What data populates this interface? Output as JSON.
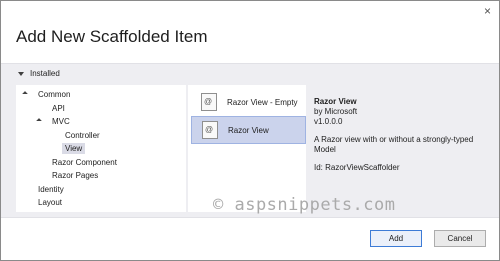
{
  "dialog": {
    "title": "Add New Scaffolded Item",
    "close_glyph": "×"
  },
  "installed_label": "Installed",
  "tree": [
    {
      "label": "Common",
      "level": 0,
      "expanded": true
    },
    {
      "label": "API",
      "level": 1
    },
    {
      "label": "MVC",
      "level": 1,
      "expanded": true
    },
    {
      "label": "Controller",
      "level": 2
    },
    {
      "label": "View",
      "level": 2,
      "selected": true
    },
    {
      "label": "Razor Component",
      "level": 1
    },
    {
      "label": "Razor Pages",
      "level": 1
    },
    {
      "label": "Identity",
      "level": 0
    },
    {
      "label": "Layout",
      "level": 0
    }
  ],
  "templates": [
    {
      "label": "Razor View - Empty",
      "icon": "razor-template-icon"
    },
    {
      "label": "Razor View",
      "icon": "razor-template-icon",
      "selected": true
    }
  ],
  "details": {
    "name": "Razor View",
    "author": "by Microsoft",
    "version": "v1.0.0.0",
    "description": "A Razor view with or without a strongly-typed Model",
    "id": "Id: RazorViewScaffolder"
  },
  "watermark": "© aspsnippets.com",
  "buttons": {
    "add": "Add",
    "cancel": "Cancel"
  },
  "colors": {
    "band": "#eeeef2",
    "selected_template": "#cbd3ec",
    "selected_tree": "#dadbe6",
    "primary_border": "#3d7bd6"
  }
}
